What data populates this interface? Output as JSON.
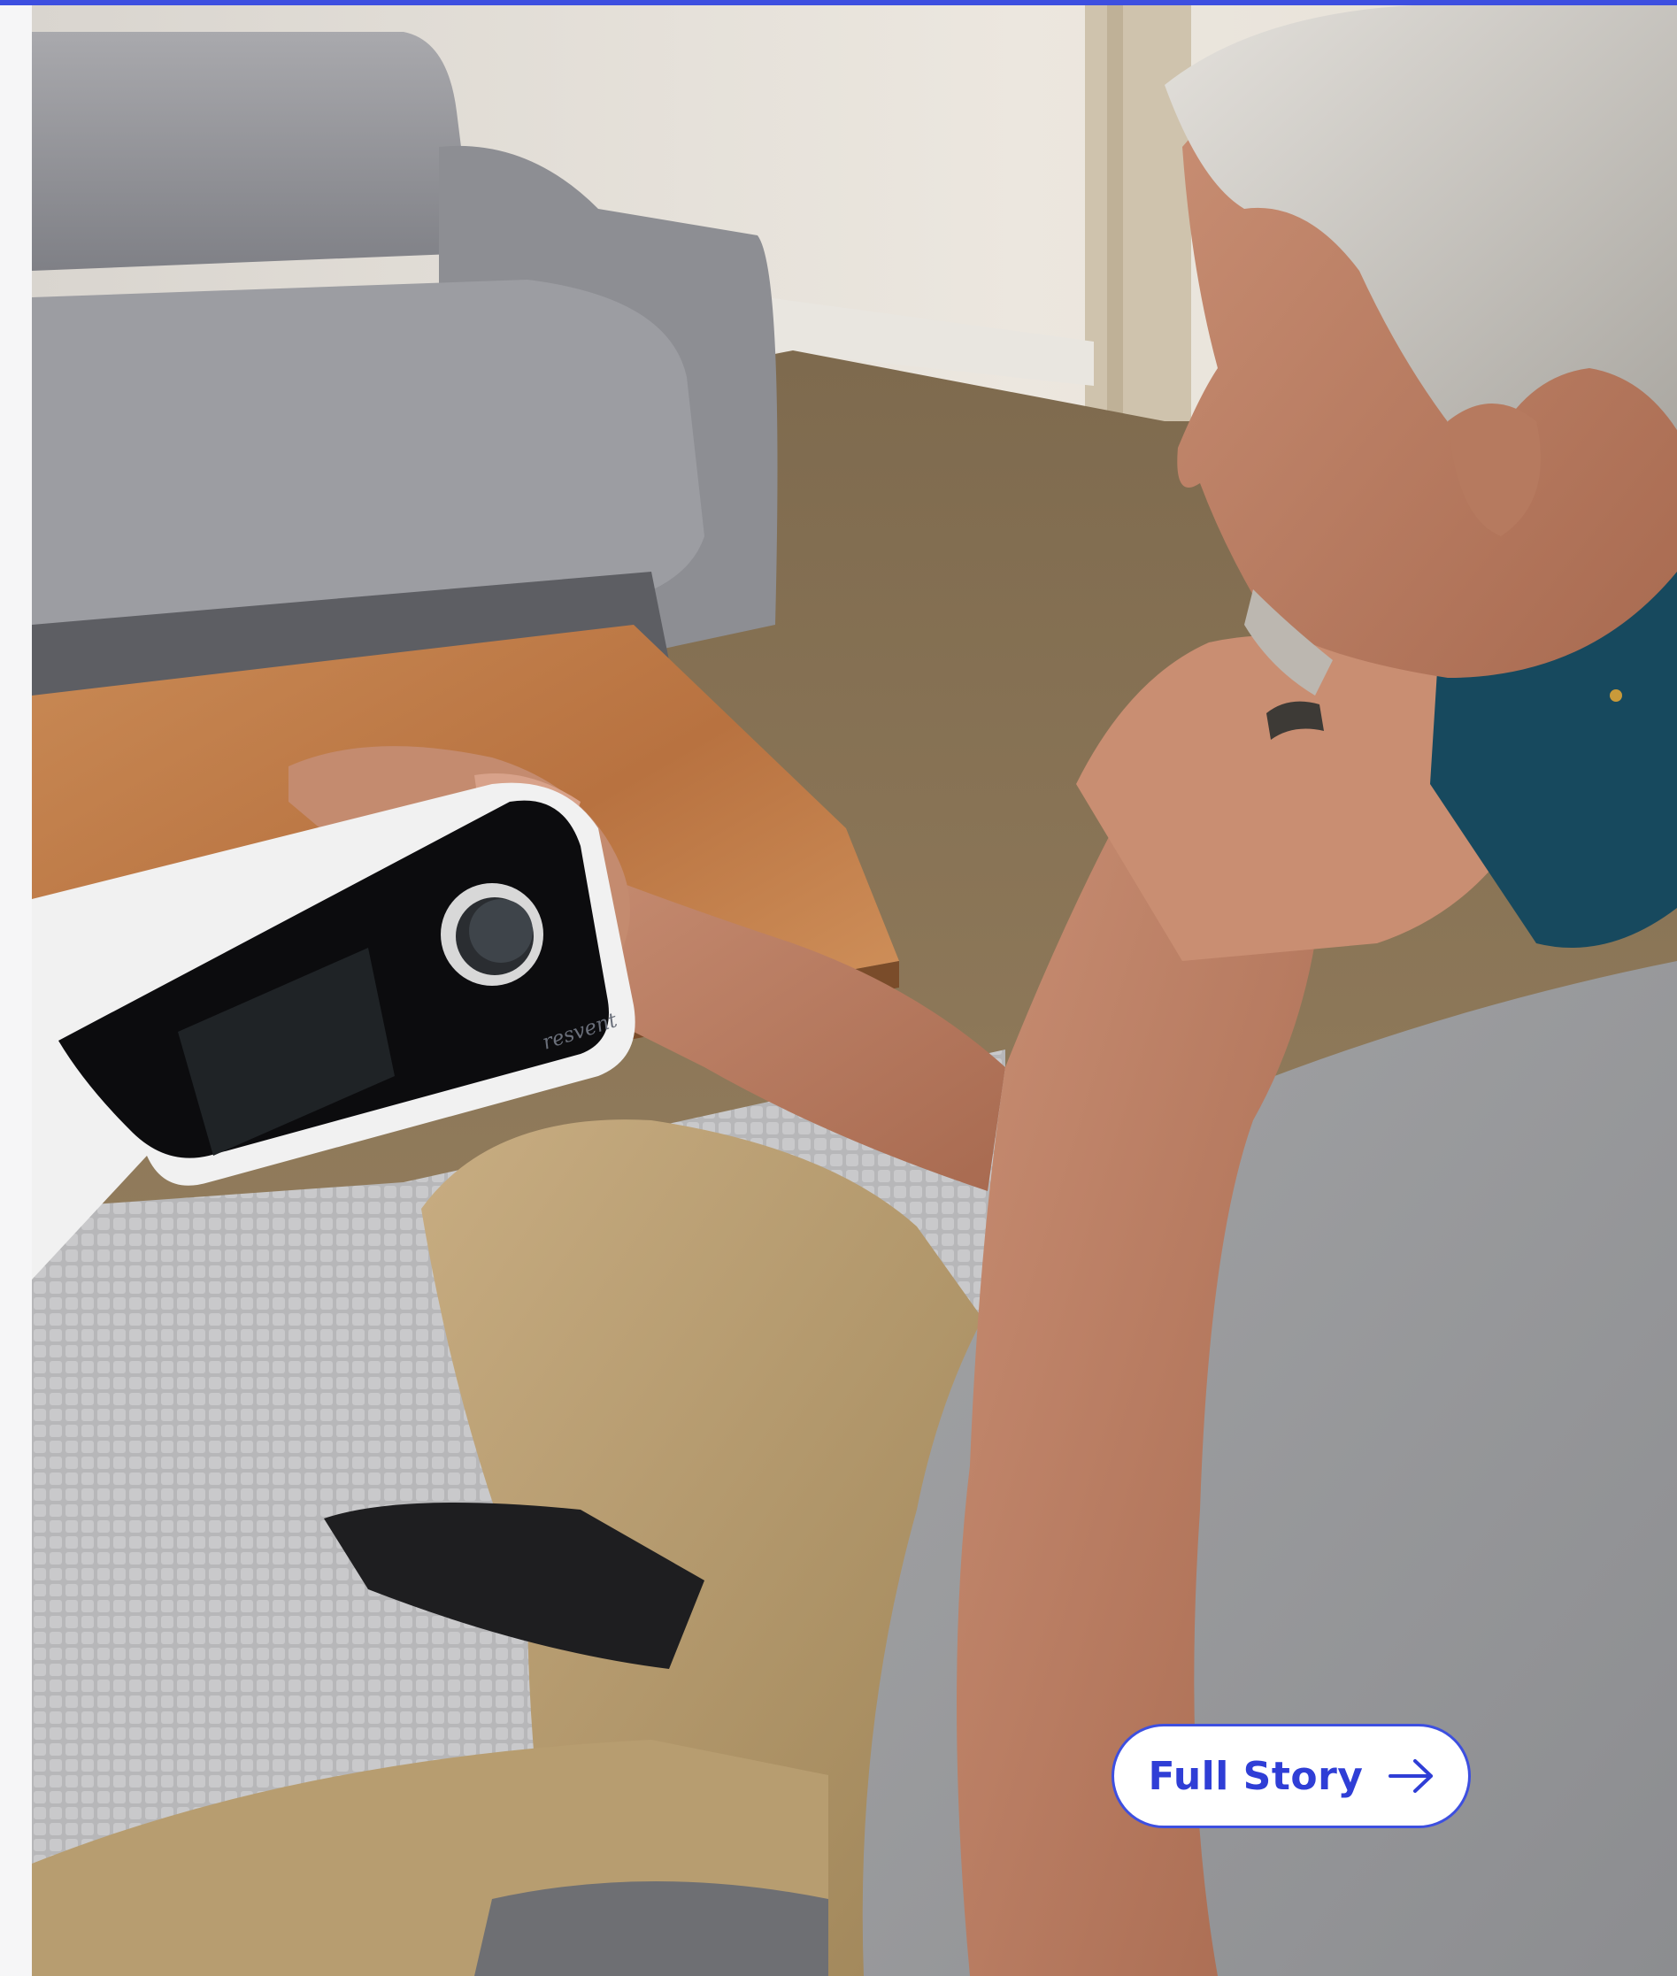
{
  "hero": {
    "device_brand": "resvent"
  },
  "cta": {
    "label": "Full Story",
    "icon": "arrow-right-icon"
  },
  "colors": {
    "accent": "#3d4fe0",
    "button_text": "#2f3ed6",
    "button_bg": "#ffffff"
  }
}
